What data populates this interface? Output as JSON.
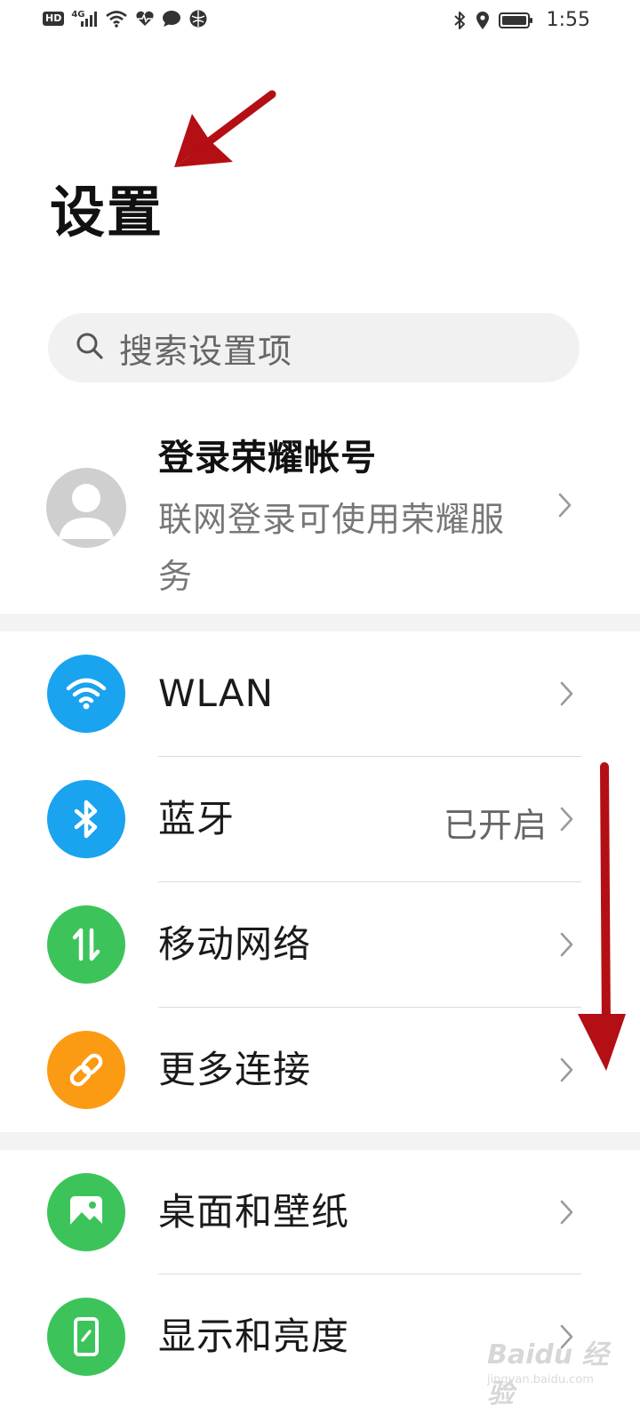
{
  "status_bar": {
    "hd_label": "HD",
    "network_label": "4G",
    "time": "1:55"
  },
  "page": {
    "title": "设置"
  },
  "search": {
    "placeholder": "搜索设置项"
  },
  "account": {
    "title": "登录荣耀帐号",
    "subtitle": "联网登录可使用荣耀服务"
  },
  "sections": [
    {
      "items": [
        {
          "label": "WLAN",
          "icon": "wifi-icon",
          "color": "#1aa3ef",
          "value": ""
        },
        {
          "label": "蓝牙",
          "icon": "bluetooth-icon",
          "color": "#1aa3ef",
          "value": "已开启"
        },
        {
          "label": "移动网络",
          "icon": "mobile-data-icon",
          "color": "#3cc45a",
          "value": ""
        },
        {
          "label": "更多连接",
          "icon": "link-icon",
          "color": "#fb9b14",
          "value": ""
        }
      ]
    },
    {
      "items": [
        {
          "label": "桌面和壁纸",
          "icon": "wallpaper-icon",
          "color": "#3cc45a",
          "value": ""
        },
        {
          "label": "显示和亮度",
          "icon": "display-icon",
          "color": "#3cc45a",
          "value": ""
        }
      ]
    }
  ],
  "watermark": {
    "brand": "Baidu 经验",
    "url": "jingyan.baidu.com"
  }
}
